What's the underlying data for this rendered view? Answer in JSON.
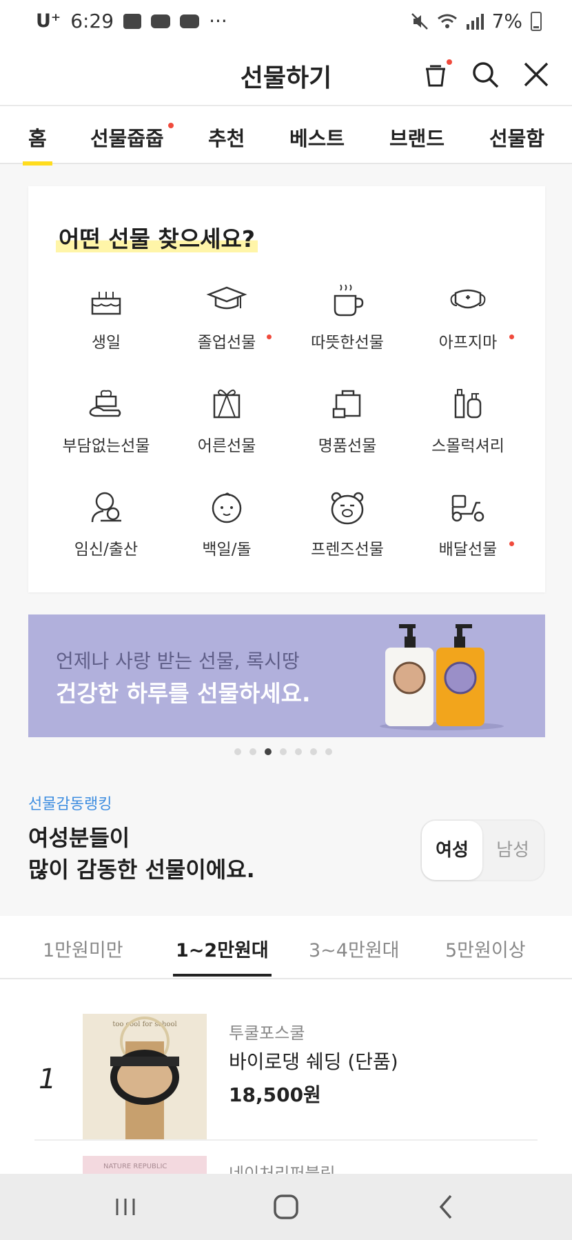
{
  "status_bar": {
    "carrier": "U⁺",
    "time": "6:29",
    "more": "···",
    "battery": "7%"
  },
  "header": {
    "title": "선물하기",
    "icons": [
      "gift-box-icon",
      "search-icon",
      "close-icon"
    ]
  },
  "tabs": [
    {
      "label": "홈",
      "active": true
    },
    {
      "label": "선물줍줍",
      "badge": true
    },
    {
      "label": "추천"
    },
    {
      "label": "베스트"
    },
    {
      "label": "브랜드"
    },
    {
      "label": "선물함"
    }
  ],
  "finder": {
    "title": "어떤 선물 찾으세요?",
    "categories": [
      {
        "label": "생일",
        "icon": "cake-icon"
      },
      {
        "label": "졸업선물",
        "icon": "graduation-cap-icon",
        "badge": true
      },
      {
        "label": "따뜻한선물",
        "icon": "hot-cup-icon"
      },
      {
        "label": "아프지마",
        "icon": "mask-icon",
        "badge": true
      },
      {
        "label": "부담없는선물",
        "icon": "small-gift-icon"
      },
      {
        "label": "어른선물",
        "icon": "wrapped-gift-icon"
      },
      {
        "label": "명품선물",
        "icon": "shopping-bag-icon"
      },
      {
        "label": "스몰럭셔리",
        "icon": "cosmetics-icon"
      },
      {
        "label": "임신/출산",
        "icon": "mother-baby-icon"
      },
      {
        "label": "백일/돌",
        "icon": "baby-face-icon"
      },
      {
        "label": "프렌즈선물",
        "icon": "bear-face-icon"
      },
      {
        "label": "배달선물",
        "icon": "delivery-scooter-icon",
        "badge": true
      }
    ]
  },
  "banner": {
    "line1": "언제나 사랑 받는 선물, 록시땅",
    "line2": "건강한 하루를 선물하세요.",
    "page_count": 7,
    "active_page": 3,
    "background": "#b1b0dc"
  },
  "ranking": {
    "label": "선물감동랭킹",
    "title_line1": "여성분들이",
    "title_line2": "많이 감동한 선물이에요.",
    "toggle": [
      {
        "label": "여성",
        "active": true
      },
      {
        "label": "남성"
      }
    ]
  },
  "price_tabs": [
    {
      "label": "1만원미만"
    },
    {
      "label": "1~2만원대",
      "active": true
    },
    {
      "label": "3~4만원대"
    },
    {
      "label": "5만원이상"
    }
  ],
  "products": [
    {
      "rank": "1",
      "brand": "투쿨포스쿨",
      "name": "바이로댕 쉐딩 (단품)",
      "price": "18,500원",
      "thumb_text": "too cool for school"
    },
    {
      "brand": "네이처리퍼블릭",
      "thumb_text": "NATURE REPUBLIC"
    }
  ],
  "colors": {
    "accent": "#ffdc1e",
    "badge": "#f04a3c",
    "rank_label": "#3d8de0"
  },
  "nav": [
    "recent-apps-icon",
    "home-icon",
    "back-icon"
  ]
}
